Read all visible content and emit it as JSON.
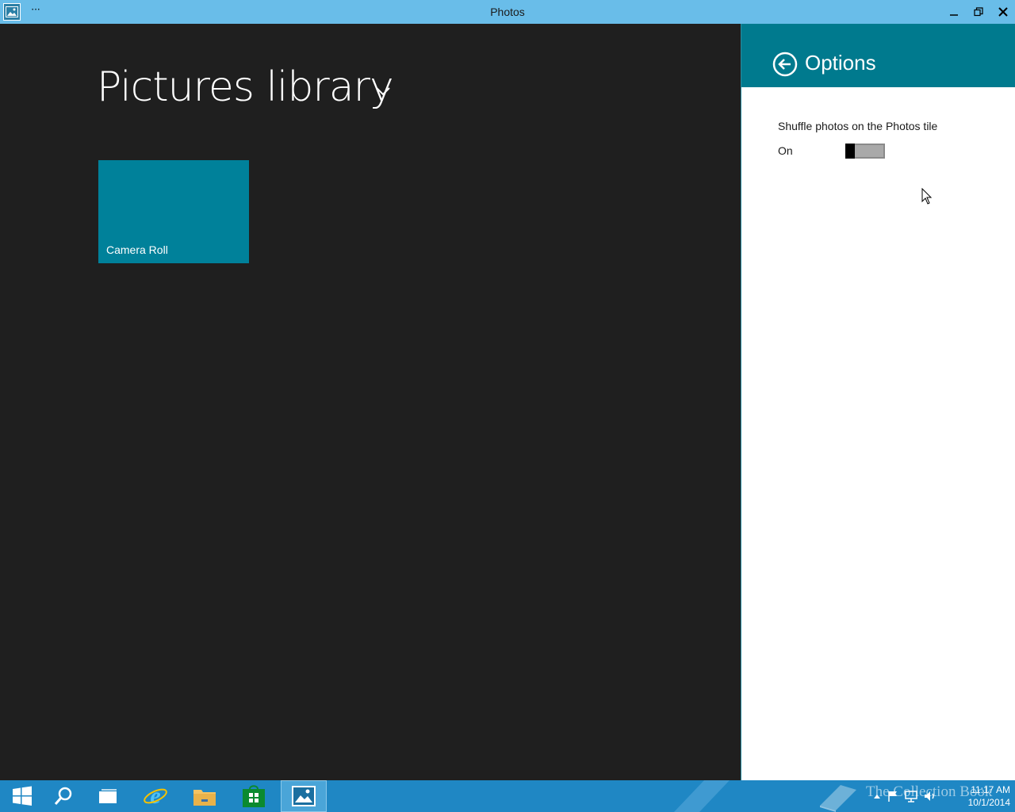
{
  "window": {
    "title": "Photos",
    "menu_glyph": "···"
  },
  "main": {
    "title": "Pictures library",
    "tiles": [
      {
        "label": "Camera Roll",
        "color": "#00819a"
      }
    ]
  },
  "flyout": {
    "title": "Options",
    "header_color": "#007a8e",
    "setting": {
      "label": "Shuffle photos on the Photos tile",
      "state_text": "On",
      "toggle_on": true
    }
  },
  "taskbar": {
    "color": "#1f87c4",
    "items": [
      {
        "icon": "windows-start-icon"
      },
      {
        "icon": "search-icon"
      },
      {
        "icon": "task-view-icon"
      },
      {
        "icon": "internet-explorer-icon"
      },
      {
        "icon": "file-explorer-icon"
      },
      {
        "icon": "store-icon"
      },
      {
        "icon": "photos-icon",
        "active": true
      }
    ],
    "watermark": "The Collection Book",
    "clock": {
      "time": "11:17 AM",
      "date": "10/1/2014"
    }
  }
}
